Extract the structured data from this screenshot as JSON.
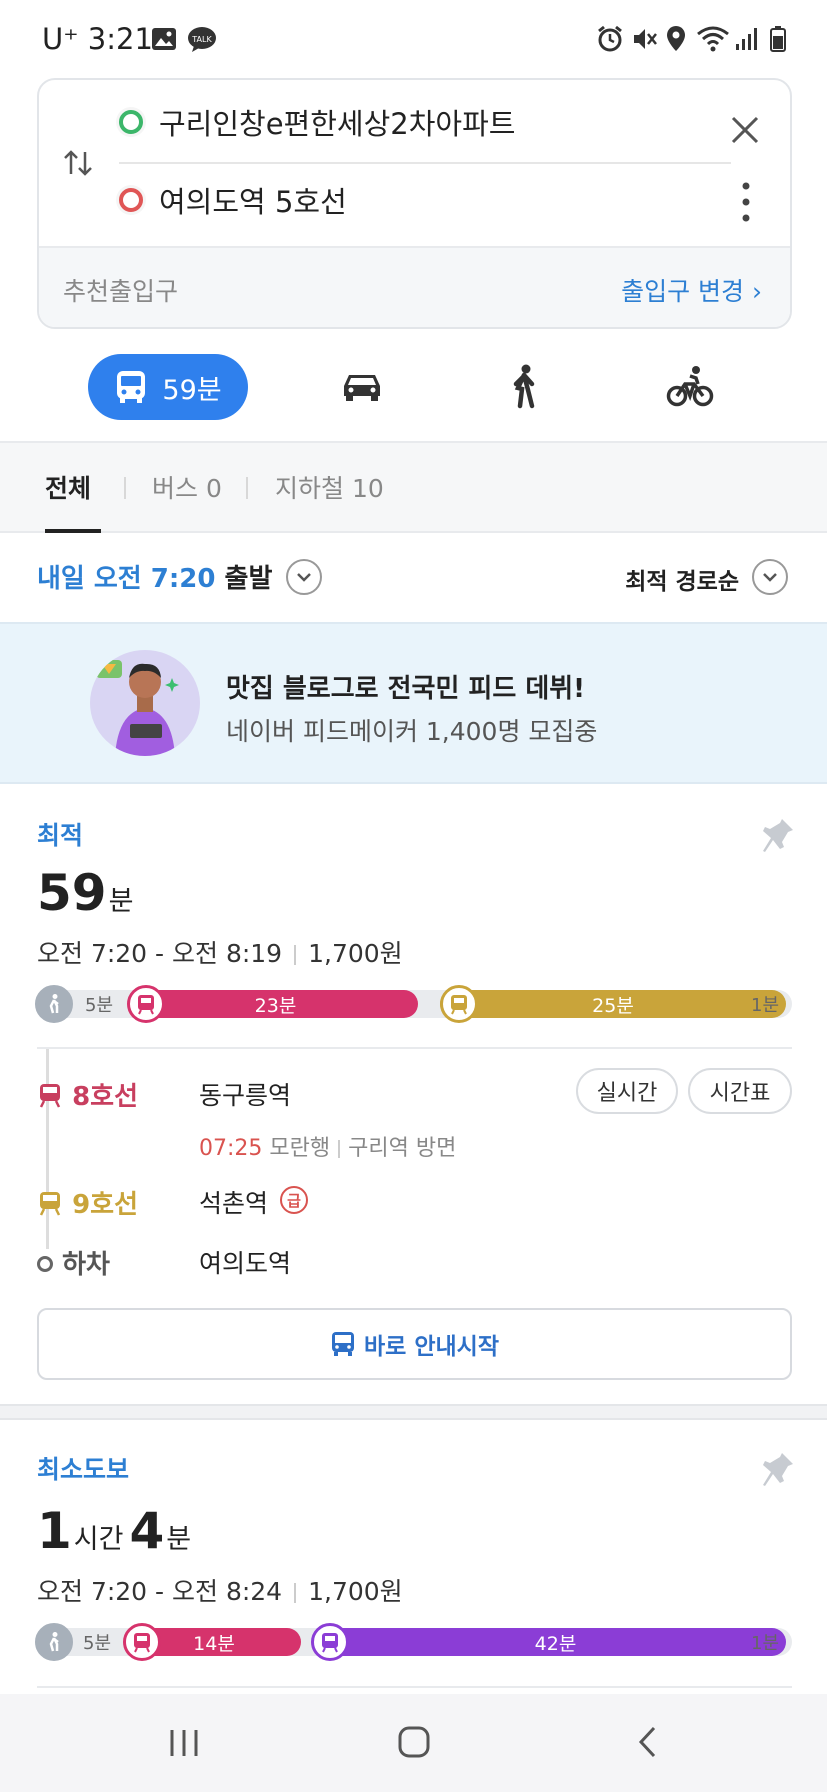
{
  "status_bar": {
    "carrier": "U⁺",
    "time": "3:21"
  },
  "search": {
    "origin": "구리인창e편한세상2차아파트",
    "destination": "여의도역 5호선",
    "entrance_label": "추천출입구",
    "entrance_change": "출입구 변경 ›"
  },
  "modes": {
    "transit_time": "59분"
  },
  "filters": {
    "all": "전체",
    "bus": "버스 0",
    "subway": "지하철 10"
  },
  "departure": {
    "highlight": "내일 오전 7:20",
    "suffix": " 출발",
    "sort": "최적 경로순"
  },
  "banner": {
    "title": "맛집 블로그로 전국민 피드 데뷔!",
    "subtitle": "네이버 피드메이커 1,400명 모집중"
  },
  "routes": [
    {
      "kind": "최적",
      "duration_num": "59",
      "duration_unit": "분",
      "times": "오전 7:20 - 오전 8:19",
      "fare": "1,700원",
      "segments": {
        "walk_start": "5분",
        "line1": "23분",
        "line2": "25분",
        "walk_end": "1분"
      },
      "steps": [
        {
          "line": "8호선",
          "stop": "동구릉역",
          "color": "#c83f5f"
        },
        {
          "line": "9호선",
          "stop": "석촌역",
          "color": "#c9a43a",
          "badge": "급"
        },
        {
          "line": "하차",
          "stop": "여의도역",
          "color": "#555555"
        }
      ],
      "arrival_time": "07:25",
      "arrival_dir": "모란행",
      "arrival_side": "구리역 방면",
      "realtime": "실시간",
      "timetable": "시간표",
      "start": "바로 안내시작"
    },
    {
      "kind": "최소도보",
      "duration_h": "1",
      "duration_h_unit": "시간",
      "duration_m": "4",
      "duration_m_unit": "분",
      "times": "오전 7:20 - 오전 8:24",
      "fare": "1,700원",
      "segments": {
        "walk_start": "5분",
        "line1": "14분",
        "line2": "42분",
        "walk_end": "1분"
      }
    }
  ],
  "colors": {
    "accent": "#2f80ed",
    "line8": "#d6336c",
    "line9": "#c9a43a",
    "purple": "#8b3dd6"
  }
}
